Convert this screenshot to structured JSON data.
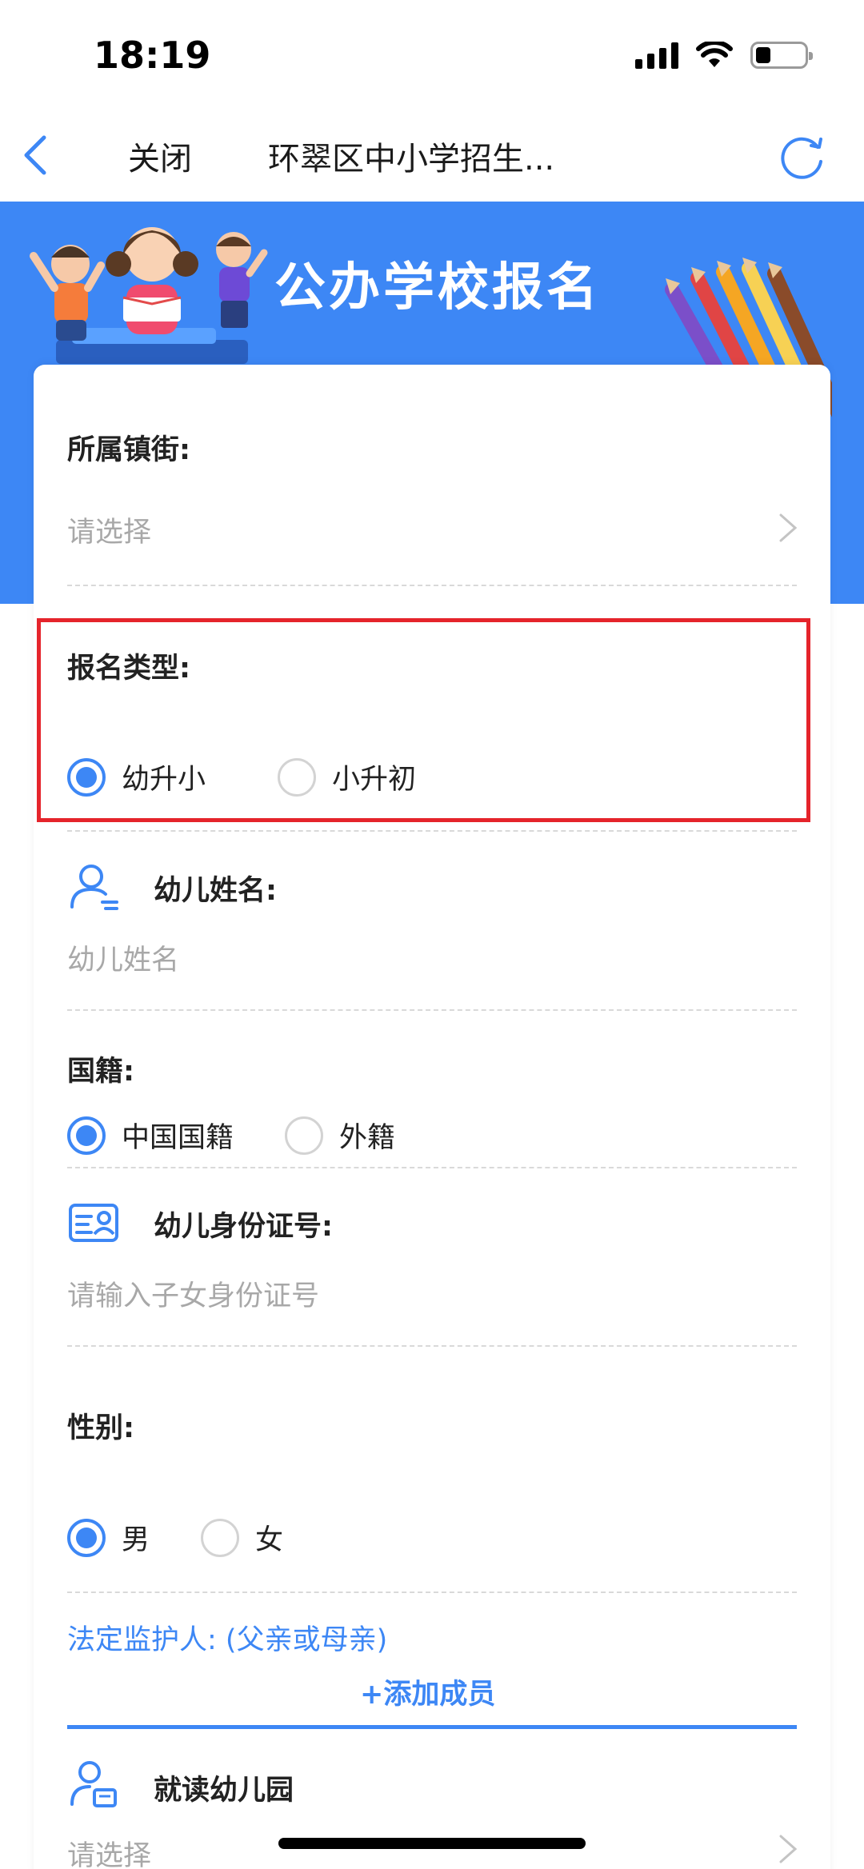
{
  "status_bar": {
    "time": "18:19"
  },
  "nav": {
    "close_label": "关闭",
    "title": "环翠区中小学招生..."
  },
  "banner": {
    "title": "公办学校报名"
  },
  "form": {
    "town": {
      "label": "所属镇街:",
      "placeholder": "请选择"
    },
    "enroll_type": {
      "label": "报名类型:",
      "options": [
        {
          "label": "幼升小",
          "selected": true
        },
        {
          "label": "小升初",
          "selected": false
        }
      ]
    },
    "child_name": {
      "label": "幼儿姓名:",
      "placeholder": "幼儿姓名"
    },
    "nationality": {
      "label": "国籍:",
      "options": [
        {
          "label": "中国国籍",
          "selected": true
        },
        {
          "label": "外籍",
          "selected": false
        }
      ]
    },
    "child_id": {
      "label": "幼儿身份证号:",
      "placeholder": "请输入子女身份证号"
    },
    "gender": {
      "label": "性别:",
      "options": [
        {
          "label": "男",
          "selected": true
        },
        {
          "label": "女",
          "selected": false
        }
      ]
    },
    "guardian": {
      "label": "法定监护人: (父亲或母亲)",
      "add_label": "+添加成员"
    },
    "kindergarten": {
      "label": "就读幼儿园",
      "placeholder": "请选择"
    }
  },
  "colors": {
    "accent": "#3d87f5",
    "highlight": "#e5242b",
    "placeholder": "#a8a8a8"
  }
}
